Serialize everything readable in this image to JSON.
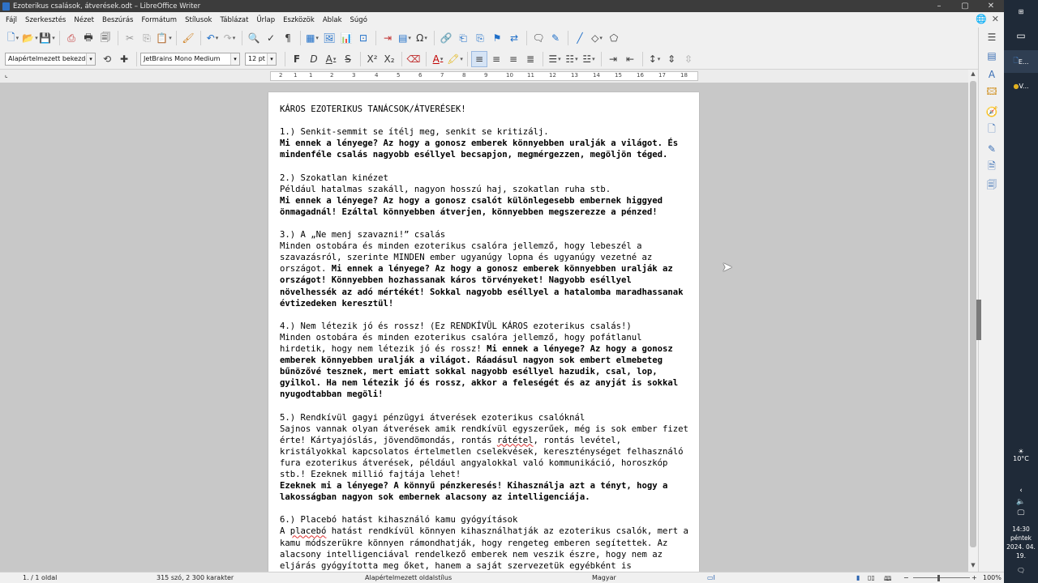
{
  "window": {
    "title": "Ezoterikus csalások, átverések.odt – LibreOffice Writer",
    "buttons": [
      "–",
      "▢",
      "✕"
    ]
  },
  "menubar": [
    "Fájl",
    "Szerkesztés",
    "Nézet",
    "Beszúrás",
    "Formátum",
    "Stílusok",
    "Táblázat",
    "Űrlap",
    "Eszközök",
    "Ablak",
    "Súgó"
  ],
  "toolbar2": {
    "para_style": "Alapértelmezett bekezdésstílus",
    "font_name": "JetBrains Mono Medium",
    "font_size": "12 pt",
    "bold": "F",
    "italic": "D",
    "underline": "A",
    "strike": "S"
  },
  "ruler": [
    "1",
    "2",
    "1",
    "2",
    "3",
    "4",
    "5",
    "6",
    "7",
    "8",
    "9",
    "10",
    "11",
    "12",
    "13",
    "14",
    "15",
    "16",
    "17",
    "18"
  ],
  "document": {
    "title": "KÁROS EZOTERIKUS TANÁCSOK/ÁTVERÉSEK!",
    "s1_h": "1.) Senkit-semmit se ítélj meg, senkit se kritizálj.",
    "s1_b": "Mi ennek a lényege? Az hogy a gonosz emberek könnyebben uralják a világot. És mindenféle csalás nagyobb eséllyel becsapjon, megmérgezzen, megöljön téged.",
    "s2_h": "2.) Szokatlan kinézet",
    "s2_t": "Például hatalmas szakáll, nagyon hosszú haj, szokatlan ruha stb.",
    "s2_b": "Mi ennek a lényege? Az hogy a gonosz csalót különlegesebb embernek higgyed önmagadnál! Ezáltal könnyebben átverjen, könnyebben megszerezze a pénzed!",
    "s3_h": "3.) A „Ne menj szavazni!” csalás",
    "s3_t": "Minden ostobára és minden ezoterikus csalóra jellemző, hogy lebeszél a szavazásról, szerinte MINDEN ember ugyanúgy lopna és ugyanúgy vezetné az országot. ",
    "s3_b": "Mi ennek a lényege? Az hogy a gonosz emberek könnyebben uralják az országot! Könnyebben hozhassanak káros törvényeket! Nagyobb eséllyel növelhessék az adó mértékét! Sokkal nagyobb eséllyel a hatalomba maradhassanak évtizedeken keresztül!",
    "s4_h": "4.) Nem létezik jó és rossz! (Ez RENDKÍVÜL KÁROS ezoterikus csalás!)",
    "s4_t": "Minden ostobára és minden ezoterikus csalóra jellemző, hogy pofátlanul hirdetik, hogy nem létezik jó és rossz! ",
    "s4_b": "Mi ennek a lényege? Az hogy a gonosz emberek könnyebben uralják a világot. Ráadásul nagyon sok embert elmebeteg bűnözővé tesznek, mert emiatt sokkal nagyobb eséllyel hazudik, csal, lop, gyilkol. Ha nem létezik jó és rossz, akkor a feleségét és az anyját is sokkal nyugodtabban megöli!",
    "s5_h": "5.) Rendkívül gagyi pénzügyi átverések ezoterikus csalóknál",
    "s5_t1": "Sajnos vannak olyan átverések amik rendkívül egyszerűek, még is sok ember fizet érte! Kártyajóslás, jövendömondás, rontás ",
    "s5_sp": "rátétel",
    "s5_t2": ", rontás levétel, kristályokkal kapcsolatos értelmetlen cselekvések, kereszténységet felhasználó fura ezoterikus átverések, például angyalokkal való kommunikáció, horoszkóp stb.! Ezeknek millió fajtája lehet!",
    "s5_b": "Ezeknek mi a lényege? A könnyű pénzkeresés! Kihasználja azt a tényt, hogy a lakosságban nagyon sok embernek alacsony az intelligenciája.",
    "s6_h": "6.) Placebó hatást kihasználó kamu gyógyítások",
    "s6_t0": "A ",
    "s6_sp": "placebó",
    "s6_t1": " hatást rendkívül könnyen kihasználhatják az ezoterikus csalók, mert a kamu módszerükre könnyen rámondhatják, hogy rengeteg emberen segítettek. Az alacsony intelligenciával rendelkező emberek nem veszik észre, hogy nem az eljárás gyógyította meg őket, hanem a saját szervezetük egyébként is"
  },
  "statusbar": {
    "page": "1. / 1 oldal",
    "words": "315 szó, 2 300 karakter",
    "style": "Alapértelmezett oldalstílus",
    "lang": "Magyar",
    "zoom": "100%"
  },
  "taskbar": {
    "app1": "E...",
    "app2": "V...",
    "temp": "10°C",
    "time": "14:30",
    "day": "péntek",
    "date": "2024. 04. 19."
  }
}
